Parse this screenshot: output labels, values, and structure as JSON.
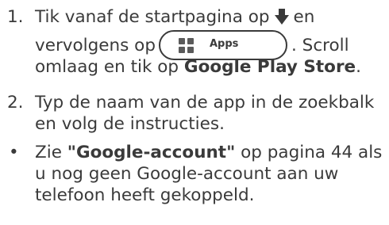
{
  "items": [
    {
      "marker": "1.",
      "line1_before": "Tik vanaf de startpagina op",
      "line1_after": "en",
      "line2_before": "vervolgens op",
      "line2_after": ". Scroll",
      "line3_before": "omlaag en tik op ",
      "line3_bold": "Google Play Store",
      "line3_after": "."
    },
    {
      "marker": "2.",
      "line1": "Typ de naam van de app in de zoekbalk",
      "line2": "en volg de instructies."
    },
    {
      "marker": "•",
      "line1_before": "Zie ",
      "line1_bold": "\"Google-account\"",
      "line1_after": " op pagina 44 als",
      "line2": "u nog geen Google-account aan uw",
      "line3": "telefoon heeft gekoppeld."
    }
  ],
  "apps_button": {
    "label": "Apps",
    "icon": "apps-grid-icon"
  },
  "arrow_icon": "down-arrow-icon",
  "colors": {
    "text": "#3a3a3a",
    "icon": "#5a5a5a"
  }
}
